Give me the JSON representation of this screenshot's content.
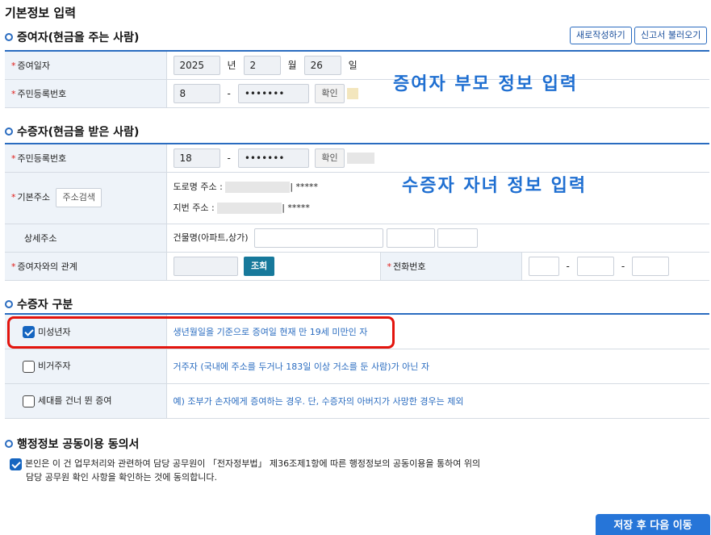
{
  "page_title": "기본정보 입력",
  "donor": {
    "section_title": "증여자(현금을 주는 사람)",
    "new_button": "새로작성하기",
    "load_button": "신고서 불러오기",
    "date_label": "증여일자",
    "year": "2025",
    "year_unit": "년",
    "month": "2",
    "month_unit": "월",
    "day": "26",
    "day_unit": "일",
    "rrn_label": "주민등록번호",
    "rrn_front": "8",
    "rrn_dash": "-",
    "rrn_back": "•••••••",
    "confirm_button": "확인",
    "overlay_note": "증여자 부모 정보 입력"
  },
  "recipient": {
    "section_title": "수증자(현금을 받은 사람)",
    "rrn_label": "주민등록번호",
    "rrn_front": "18",
    "rrn_dash": "-",
    "rrn_back": "•••••••",
    "confirm_button": "확인",
    "address_label": "기본주소",
    "address_search_button": "주소검색",
    "road_label": "도로명 주소 :",
    "road_tail": "*****",
    "lot_label": "지번 주소 :",
    "lot_tail": "*****",
    "detail_label": "상세주소",
    "building_label": "건물명(아파트,상가)",
    "relation_label": "증여자와의 관계",
    "lookup_button": "조회",
    "phone_label": "전화번호",
    "phone_dash": "-",
    "overlay_note": "수증자 자녀 정보 입력"
  },
  "division": {
    "section_title": "수증자 구분",
    "rows": [
      {
        "label": "미성년자",
        "checked": true,
        "desc": "생년월일을 기준으로 증여일 현재 만 19세 미만인 자"
      },
      {
        "label": "비거주자",
        "checked": false,
        "desc": "거주자 (국내에 주소를 두거나 183일 이상 거소를 둔 사람)가 아닌 자"
      },
      {
        "label": "세대를 건너 뛴 증여",
        "checked": false,
        "desc": "예) 조부가 손자에게 증여하는 경우. 단, 수증자의 아버지가 사망한 경우는 제외"
      }
    ]
  },
  "consent": {
    "section_title": "행정정보 공동이용 동의서",
    "checked": true,
    "line1": "본인은 이 건 업무처리와 관련하여 담당 공무원이 「전자정부법」 제36조제1항에 따른 행정정보의 공동이용을 통하여 위의",
    "line2": "담당 공무원 확인 사항을 확인하는 것에 동의합니다."
  },
  "save_button": "저장 후 다음 이동",
  "colors": {
    "accent": "#2a6cc0",
    "highlight": "#e3140d",
    "save": "#2675d8"
  }
}
